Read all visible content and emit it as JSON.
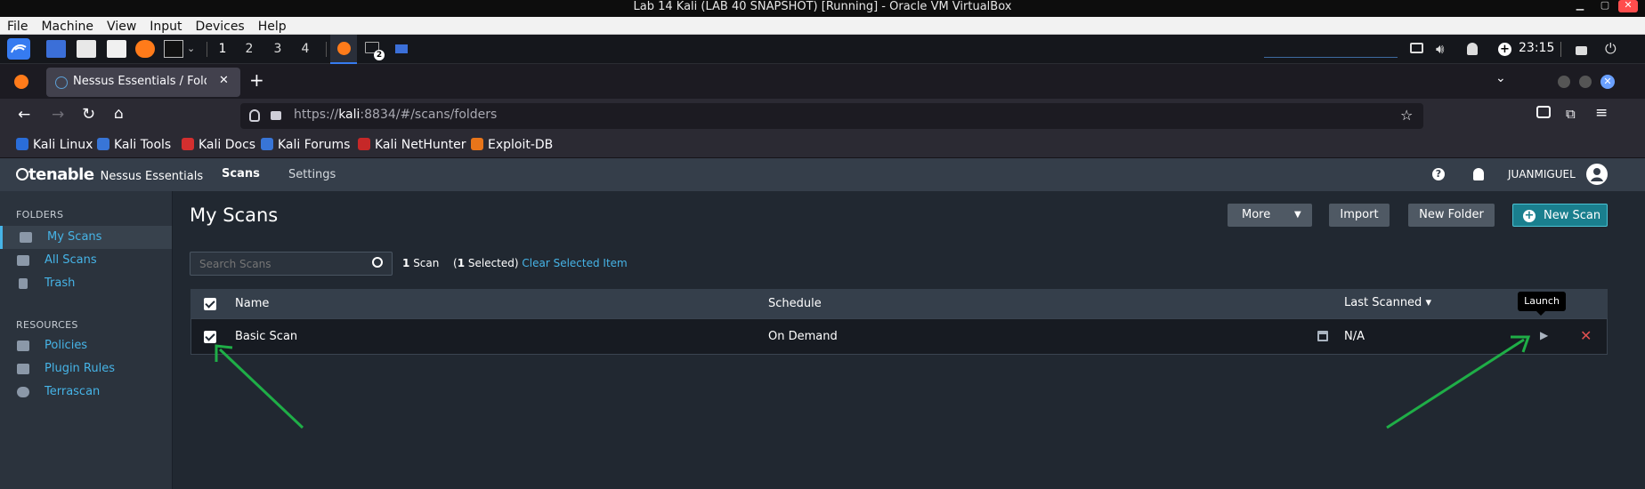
{
  "vbox": {
    "title": "Lab 14 Kali (LAB 40 SNAPSHOT) [Running] - Oracle VM VirtualBox",
    "menu": [
      "File",
      "Machine",
      "View",
      "Input",
      "Devices",
      "Help"
    ]
  },
  "panel": {
    "workspaces": [
      "1",
      "2",
      "3",
      "4"
    ],
    "clock": "23:15",
    "badge": "2"
  },
  "browser": {
    "tab_title": "Nessus Essentials / Folders",
    "url_prefix": "https://",
    "url_host": "kali",
    "url_rest": ":8834/#/scans/folders",
    "bookmarks": [
      "Kali Linux",
      "Kali Tools",
      "Kali Docs",
      "Kali Forums",
      "Kali NetHunter",
      "Exploit-DB"
    ]
  },
  "nessus": {
    "brand": "tenable",
    "product": "Nessus Essentials",
    "nav": [
      "Scans",
      "Settings"
    ],
    "user": "JUANMIGUEL",
    "sidebar": {
      "folders_header": "FOLDERS",
      "folders": [
        "My Scans",
        "All Scans",
        "Trash"
      ],
      "resources_header": "RESOURCES",
      "resources": [
        "Policies",
        "Plugin Rules",
        "Terrascan"
      ]
    },
    "page_title": "My Scans",
    "buttons": {
      "more": "More",
      "import": "Import",
      "new_folder": "New Folder",
      "new_scan": "New Scan"
    },
    "search_placeholder": "Search Scans",
    "scan_count_num": "1",
    "scan_count_label": "Scan",
    "selected_num": "1",
    "selected_label": " Selected)",
    "clear_selected": "Clear Selected Item",
    "table": {
      "headers": [
        "Name",
        "Schedule",
        "Last Scanned ▾"
      ],
      "rows": [
        {
          "name": "Basic Scan",
          "schedule": "On Demand",
          "last": "N/A"
        }
      ]
    },
    "tooltip": "Launch"
  },
  "colors": {
    "accent": "#46b4e7",
    "new_scan_btn": "#1a7f8e",
    "delete": "#e05050",
    "arrow": "#1fae47"
  }
}
